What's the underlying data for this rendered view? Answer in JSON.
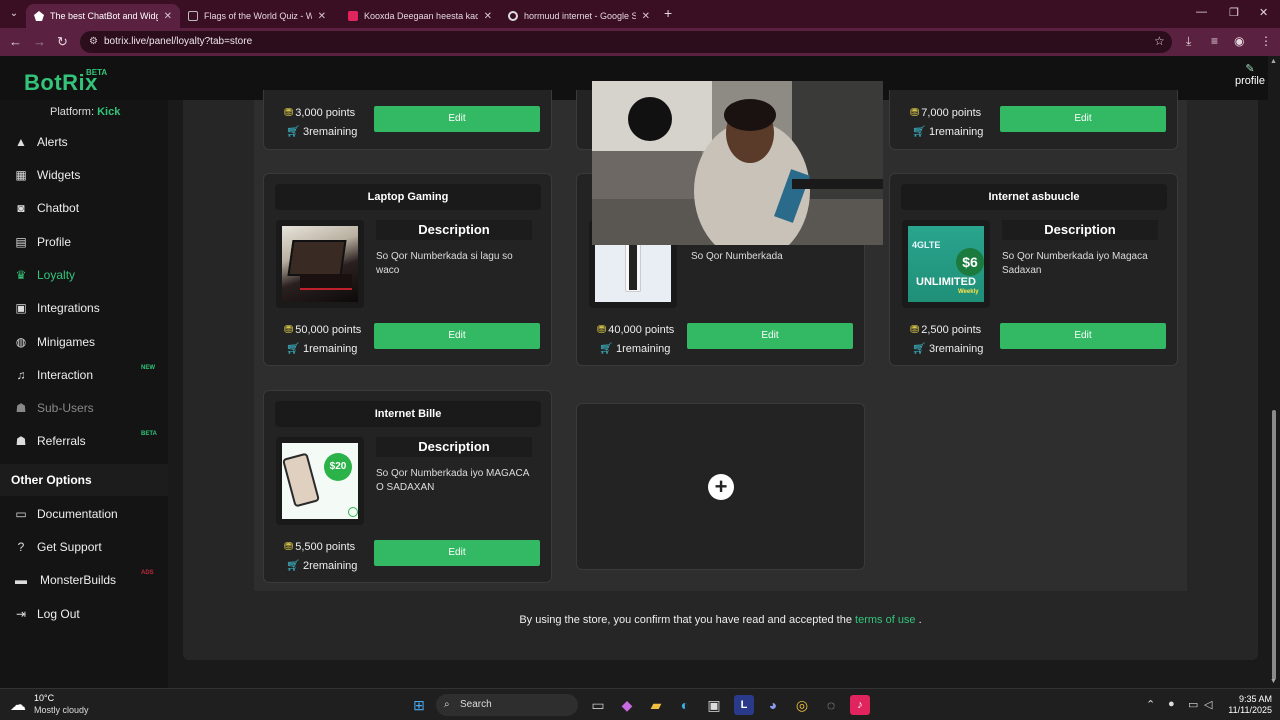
{
  "browser": {
    "tabs": [
      {
        "title": "The best ChatBot and Widgets",
        "active": true
      },
      {
        "title": "Flags of the World Quiz - World",
        "active": false
      },
      {
        "title": "Kooxda Deegaan heesta kacdan",
        "active": false
      },
      {
        "title": "hormuud internet - Google Search",
        "active": false
      }
    ],
    "url": "botrix.live/panel/loyalty?tab=store"
  },
  "header": {
    "logo": "BotRix",
    "beta": "BETA",
    "profile_label": "profile"
  },
  "sidebar": {
    "platform_label": "Platform:",
    "platform_value": "Kick",
    "items": [
      {
        "label": "Alerts",
        "icon": "warning-icon"
      },
      {
        "label": "Widgets",
        "icon": "grid-icon"
      },
      {
        "label": "Chatbot",
        "icon": "robot-icon"
      },
      {
        "label": "Profile",
        "icon": "id-card-icon"
      },
      {
        "label": "Loyalty",
        "icon": "trophy-icon",
        "active": true
      },
      {
        "label": "Integrations",
        "icon": "link-icon"
      },
      {
        "label": "Minigames",
        "icon": "gamepad-icon"
      },
      {
        "label": "Interaction",
        "icon": "music-icon",
        "tag": "NEW"
      },
      {
        "label": "Sub-Users",
        "icon": "users-icon",
        "disabled": true
      },
      {
        "label": "Referrals",
        "icon": "user-plus-icon",
        "tag": "BETA"
      }
    ],
    "other_options_title": "Other Options",
    "other_items": [
      {
        "label": "Documentation",
        "icon": "book-icon"
      },
      {
        "label": "Get Support",
        "icon": "question-icon"
      },
      {
        "label": "MonsterBuilds",
        "icon": "laptop-icon",
        "tag": "ADS"
      },
      {
        "label": "Log Out",
        "icon": "logout-icon"
      }
    ]
  },
  "store": {
    "items": [
      {
        "title": "",
        "points": "3,000 points",
        "remaining": "3remaining",
        "edit": "Edit"
      },
      {
        "title": "",
        "points": "",
        "remaining": "",
        "edit": ""
      },
      {
        "title": "",
        "points": "7,000 points",
        "remaining": "1remaining",
        "edit": "Edit"
      },
      {
        "title": "Laptop Gaming",
        "desc_heading": "Description",
        "description": "So Qor Numberkada si lagu so waco",
        "points": "50,000 points",
        "remaining": "1remaining",
        "edit": "Edit"
      },
      {
        "title": "",
        "desc_heading": "",
        "description": "So Qor Numberkada",
        "points": "40,000 points",
        "remaining": "1remaining",
        "edit": "Edit"
      },
      {
        "title": "Internet asbuucle",
        "desc_heading": "Description",
        "description": "So Qor Numberkada iyo Magaca Sadaxan",
        "points": "2,500 points",
        "remaining": "3remaining",
        "edit": "Edit"
      },
      {
        "title": "Internet Bille",
        "desc_heading": "Description",
        "description": "So Qor Numberkada iyo MAGACA O SADAXAN",
        "points": "5,500 points",
        "remaining": "2remaining",
        "edit": "Edit"
      }
    ],
    "thumb_texts": {
      "unlimited_price": "$6",
      "unlimited_label": "UNLIMITED",
      "unlimited_top": "4GLTE",
      "unlimited_period": "Weekly",
      "bille_price": "$20"
    },
    "footer_text": "By using the store, you confirm that you have read and accepted the",
    "footer_link": "terms of use",
    "footer_end": "."
  },
  "taskbar": {
    "temp": "10°C",
    "weather": "Mostly cloudy",
    "search": "Search",
    "time": "9:35 AM",
    "date": "11/11/2025"
  },
  "colors": {
    "accent": "#33c47a",
    "edit_button": "#33b864",
    "tab_strip": "#3a0f24",
    "address_bar": "#5a2240"
  }
}
